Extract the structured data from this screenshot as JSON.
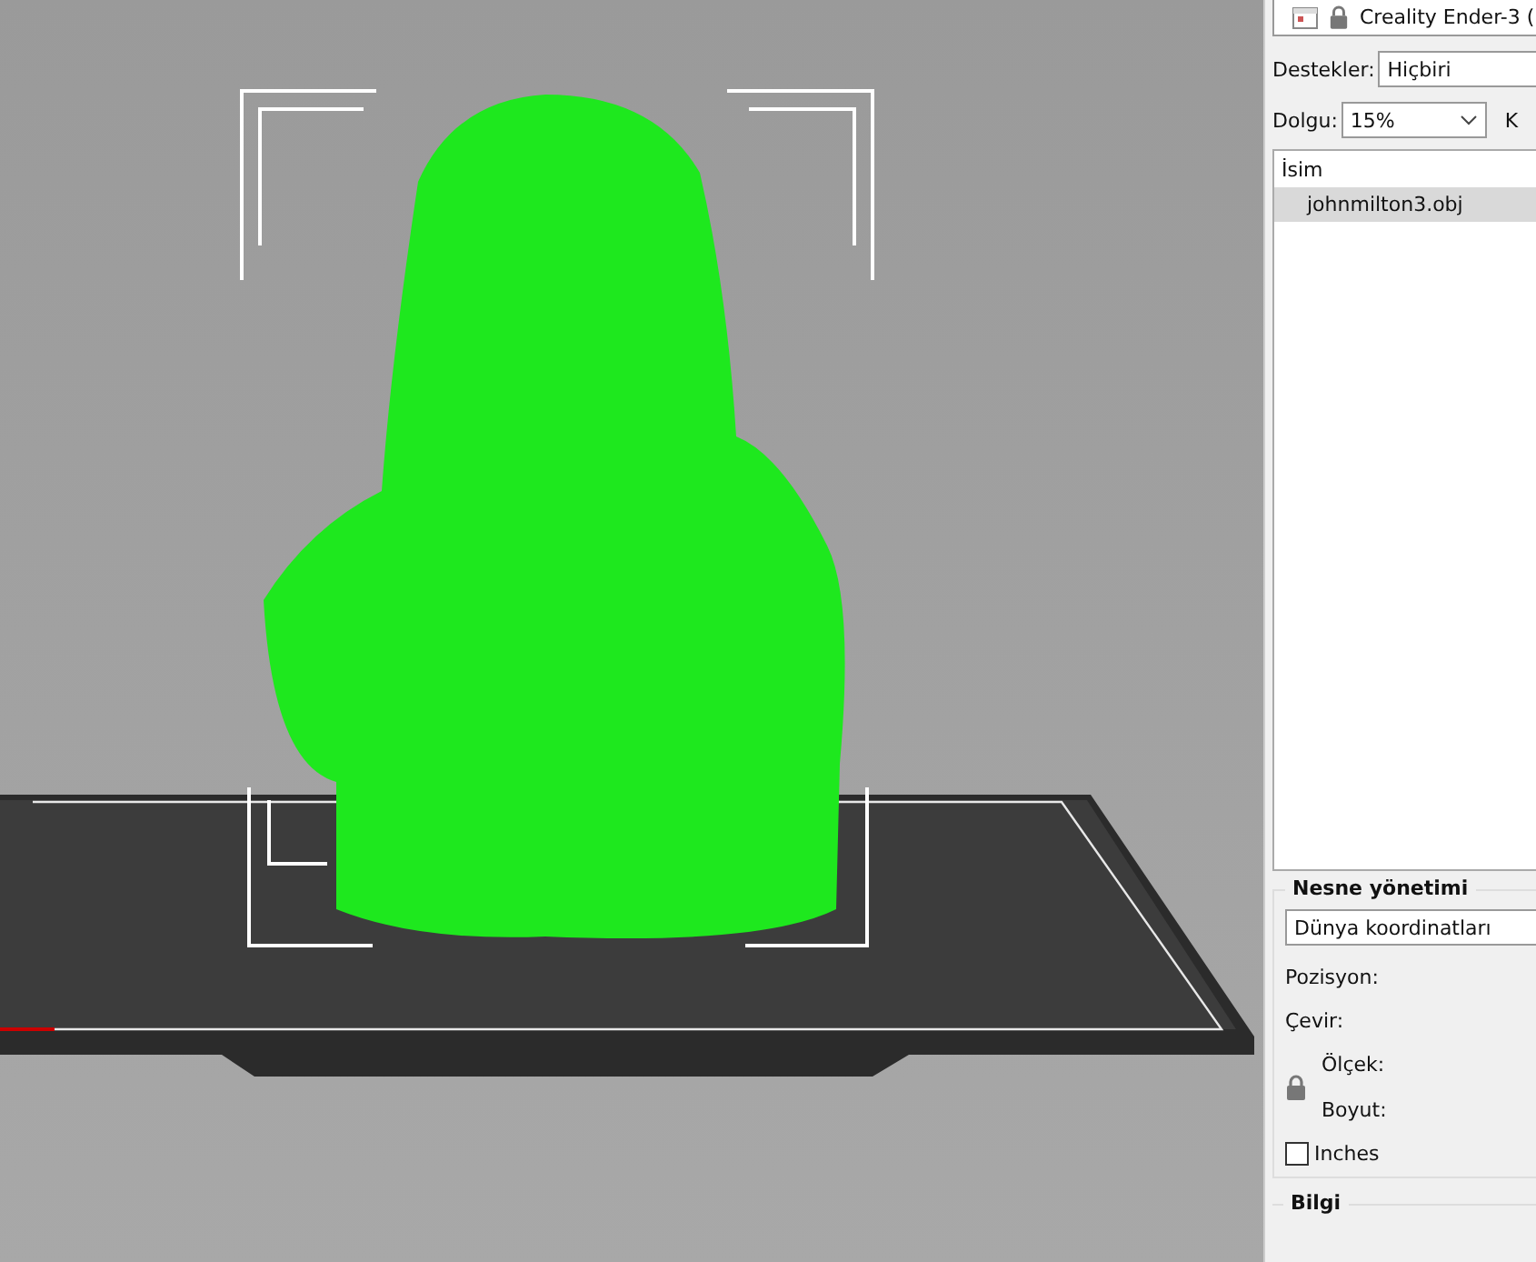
{
  "printer": {
    "label": "Creality Ender-3 ("
  },
  "supports": {
    "label": "Destekler:",
    "value": "Hiçbiri"
  },
  "infill": {
    "label": "Dolgu:",
    "value": "15%",
    "next_label": "K"
  },
  "object_list": {
    "header": "İsim",
    "rows": [
      {
        "name": "johnmilton3.obj",
        "selected": true
      }
    ]
  },
  "object_manipulation": {
    "title": "Nesne yönetimi",
    "coordinates": "Dünya koordinatları",
    "position": "Pozisyon:",
    "rotate": "Çevir:",
    "scale": "Ölçek:",
    "size": "Boyut:",
    "inches": {
      "label": "Inches",
      "checked": false
    }
  },
  "info": {
    "title": "Bilgi"
  }
}
